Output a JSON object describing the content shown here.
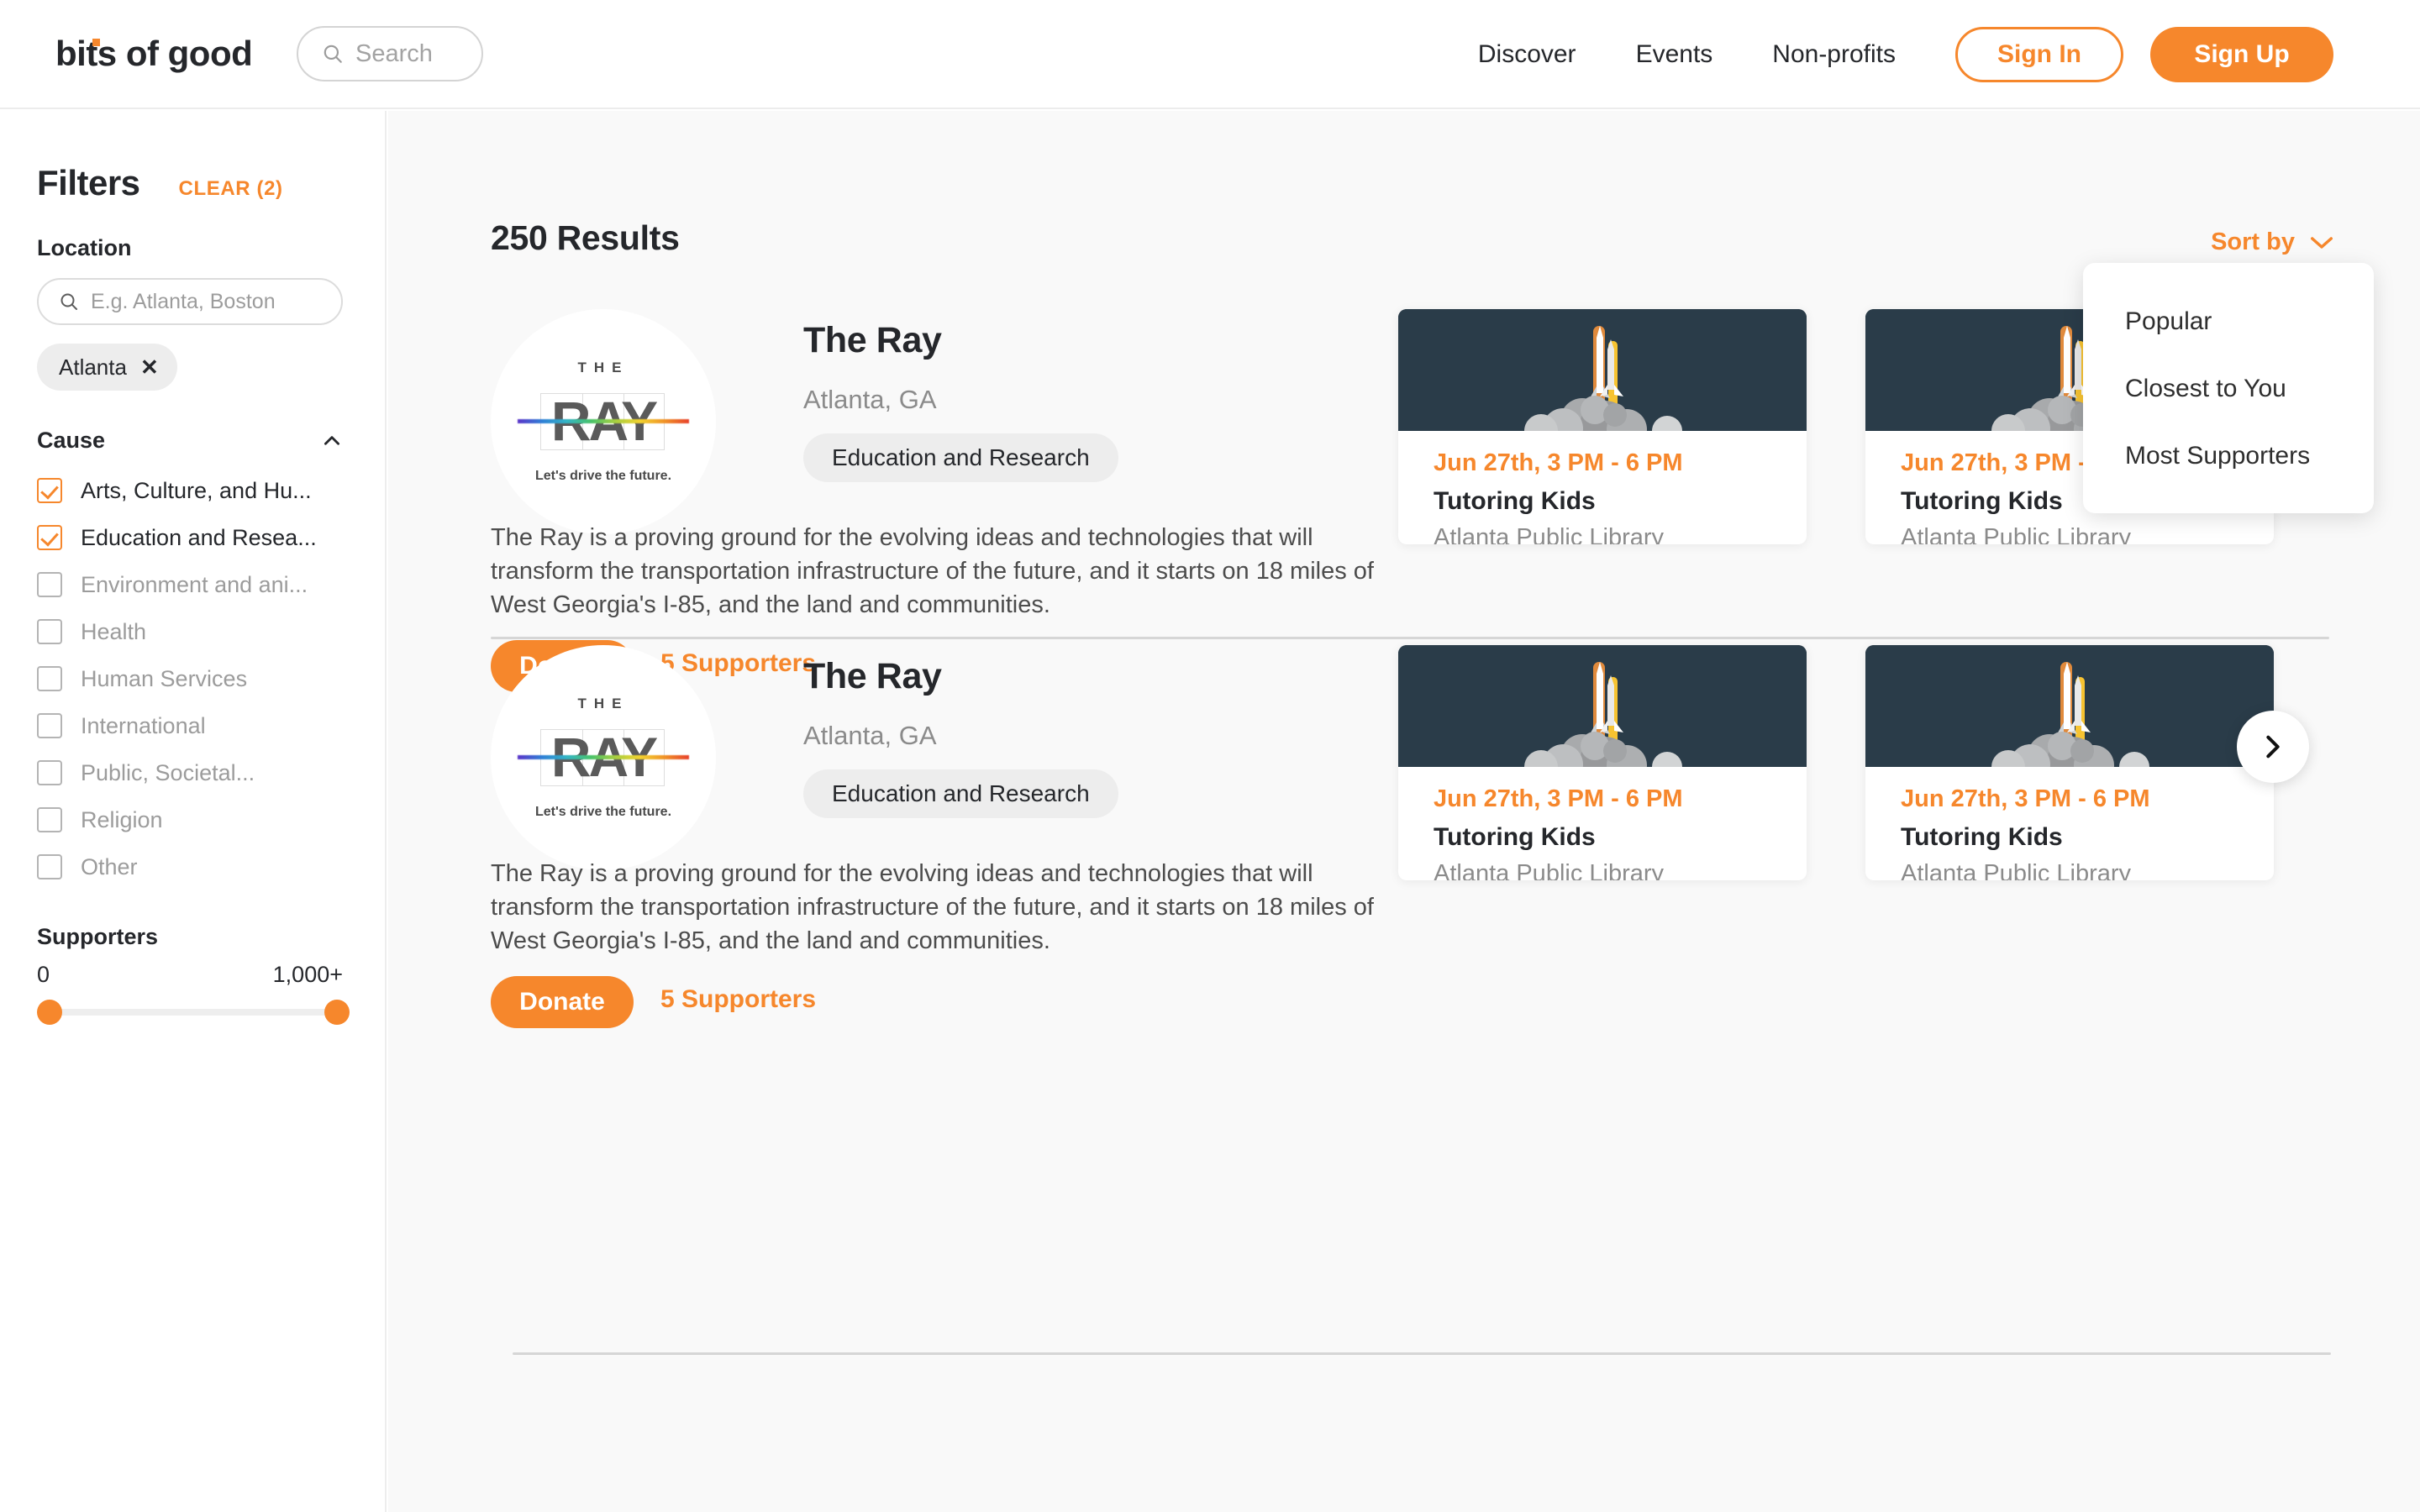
{
  "header": {
    "logo_text": "bits of good",
    "search_placeholder": "Search",
    "search_icon": "search-icon",
    "nav": [
      {
        "label": "Discover"
      },
      {
        "label": "Events"
      },
      {
        "label": "Non-profits"
      }
    ],
    "sign_in_label": "Sign In",
    "sign_up_label": "Sign Up"
  },
  "sidebar": {
    "title": "Filters",
    "clear_label": "CLEAR (2)",
    "location": {
      "title": "Location",
      "input_placeholder": "E.g. Atlanta, Boston",
      "search_icon": "search-icon",
      "chips": [
        {
          "label": "Atlanta",
          "remove_icon": "close-icon"
        }
      ]
    },
    "cause": {
      "title": "Cause",
      "collapse_icon": "chevron-up-icon",
      "options": [
        {
          "label": "Arts, Culture, and Hu...",
          "checked": true
        },
        {
          "label": "Education and Resea...",
          "checked": true
        },
        {
          "label": "Environment and ani...",
          "checked": false
        },
        {
          "label": "Health",
          "checked": false
        },
        {
          "label": "Human Services",
          "checked": false
        },
        {
          "label": "International",
          "checked": false
        },
        {
          "label": "Public, Societal...",
          "checked": false
        },
        {
          "label": "Religion",
          "checked": false
        },
        {
          "label": "Other",
          "checked": false
        }
      ]
    },
    "supporters": {
      "title": "Supporters",
      "min_label": "0",
      "max_label": "1,000+"
    }
  },
  "main": {
    "results_count": "250 Results",
    "sort": {
      "label": "Sort by",
      "chevron_icon": "chevron-down-icon",
      "open": true,
      "options": [
        {
          "label": "Popular"
        },
        {
          "label": "Closest to You"
        },
        {
          "label": "Most Supporters"
        }
      ]
    },
    "carousel_next_icon": "chevron-right-icon",
    "results": [
      {
        "name": "The Ray",
        "location": "Atlanta, GA",
        "tag": "Education and Research",
        "description": "The Ray is a proving ground for the evolving ideas and technologies that will transform the transportation infrastructure of the future, and it starts on 18 miles of West Georgia's I-85, and the land and communities.",
        "donate_label": "Donate",
        "supporters_label": "5 Supporters",
        "logo": {
          "top_text": "THE",
          "main_text": "RAY",
          "tagline": "Let's drive the future."
        },
        "events": [
          {
            "date": "Jun 27th, 3 PM - 6 PM",
            "title": "Tutoring Kids",
            "location": "Atlanta Public Library",
            "image": "rocket-launch-illustration"
          },
          {
            "date": "Jun 27th, 3 PM - 6 PM",
            "title": "Tutoring Kids",
            "location": "Atlanta Public Library",
            "image": "rocket-launch-illustration"
          }
        ]
      },
      {
        "name": "The Ray",
        "location": "Atlanta, GA",
        "tag": "Education and Research",
        "description": "The Ray is a proving ground for the evolving ideas and technologies that will transform the transportation infrastructure of the future, and it starts on 18 miles of West Georgia's I-85, and the land and communities.",
        "donate_label": "Donate",
        "supporters_label": "5 Supporters",
        "logo": {
          "top_text": "THE",
          "main_text": "RAY",
          "tagline": "Let's drive the future."
        },
        "events": [
          {
            "date": "Jun 27th, 3 PM - 6 PM",
            "title": "Tutoring Kids",
            "location": "Atlanta Public Library",
            "image": "rocket-launch-illustration"
          },
          {
            "date": "Jun 27th, 3 PM - 6 PM",
            "title": "Tutoring Kids",
            "location": "Atlanta Public Library",
            "image": "rocket-launch-illustration"
          }
        ]
      }
    ]
  },
  "colors": {
    "accent_orange": "#f6872c",
    "dark_navy": "#2a3c49",
    "text_dark": "#25272b",
    "text_muted": "#8b8b8b",
    "chip_gray": "#ededed",
    "page_bg": "#f9f9f9"
  }
}
